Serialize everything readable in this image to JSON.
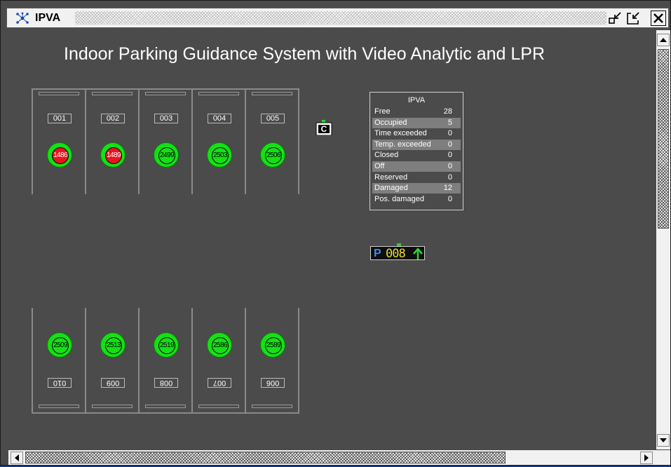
{
  "window": {
    "title": "IPVA",
    "icons": {
      "app": "network-icon",
      "minimize": "minimize-icon",
      "restore": "restore-icon",
      "close": "close-icon"
    }
  },
  "main_title": "Indoor Parking Guidance System with Video Analytic and LPR",
  "top_row": [
    {
      "label": "001",
      "sensor": "1486",
      "status": "occupied"
    },
    {
      "label": "002",
      "sensor": "1489",
      "status": "occupied"
    },
    {
      "label": "003",
      "sensor": "2499",
      "status": "free"
    },
    {
      "label": "004",
      "sensor": "2503",
      "status": "free"
    },
    {
      "label": "005",
      "sensor": "2506",
      "status": "free"
    }
  ],
  "bottom_row": [
    {
      "label": "010",
      "sensor": "2509",
      "status": "free"
    },
    {
      "label": "009",
      "sensor": "2513",
      "status": "free"
    },
    {
      "label": "008",
      "sensor": "2519",
      "status": "free"
    },
    {
      "label": "007",
      "sensor": "2586",
      "status": "free"
    },
    {
      "label": "006",
      "sensor": "2589",
      "status": "free"
    }
  ],
  "camera_icon": "camera-icon",
  "stats": {
    "title": "IPVA",
    "rows": [
      {
        "label": "Free",
        "value": "28"
      },
      {
        "label": "Occupied",
        "value": "5"
      },
      {
        "label": "Time exceeded",
        "value": "0"
      },
      {
        "label": "Temp. exceeded",
        "value": "0"
      },
      {
        "label": "Closed",
        "value": "0"
      },
      {
        "label": "Off",
        "value": "0"
      },
      {
        "label": "Reserved",
        "value": "0"
      },
      {
        "label": "Damaged",
        "value": "12"
      },
      {
        "label": "Pos. damaged",
        "value": "0"
      }
    ]
  },
  "display": {
    "letter": "P",
    "count": "008",
    "arrow": "arrow-up-icon"
  },
  "colors": {
    "free": "#15e015",
    "occupied": "#e8141c",
    "background": "#4b4b4b",
    "display_count": "#e9dd2a",
    "display_letter": "#3e8cf0"
  }
}
